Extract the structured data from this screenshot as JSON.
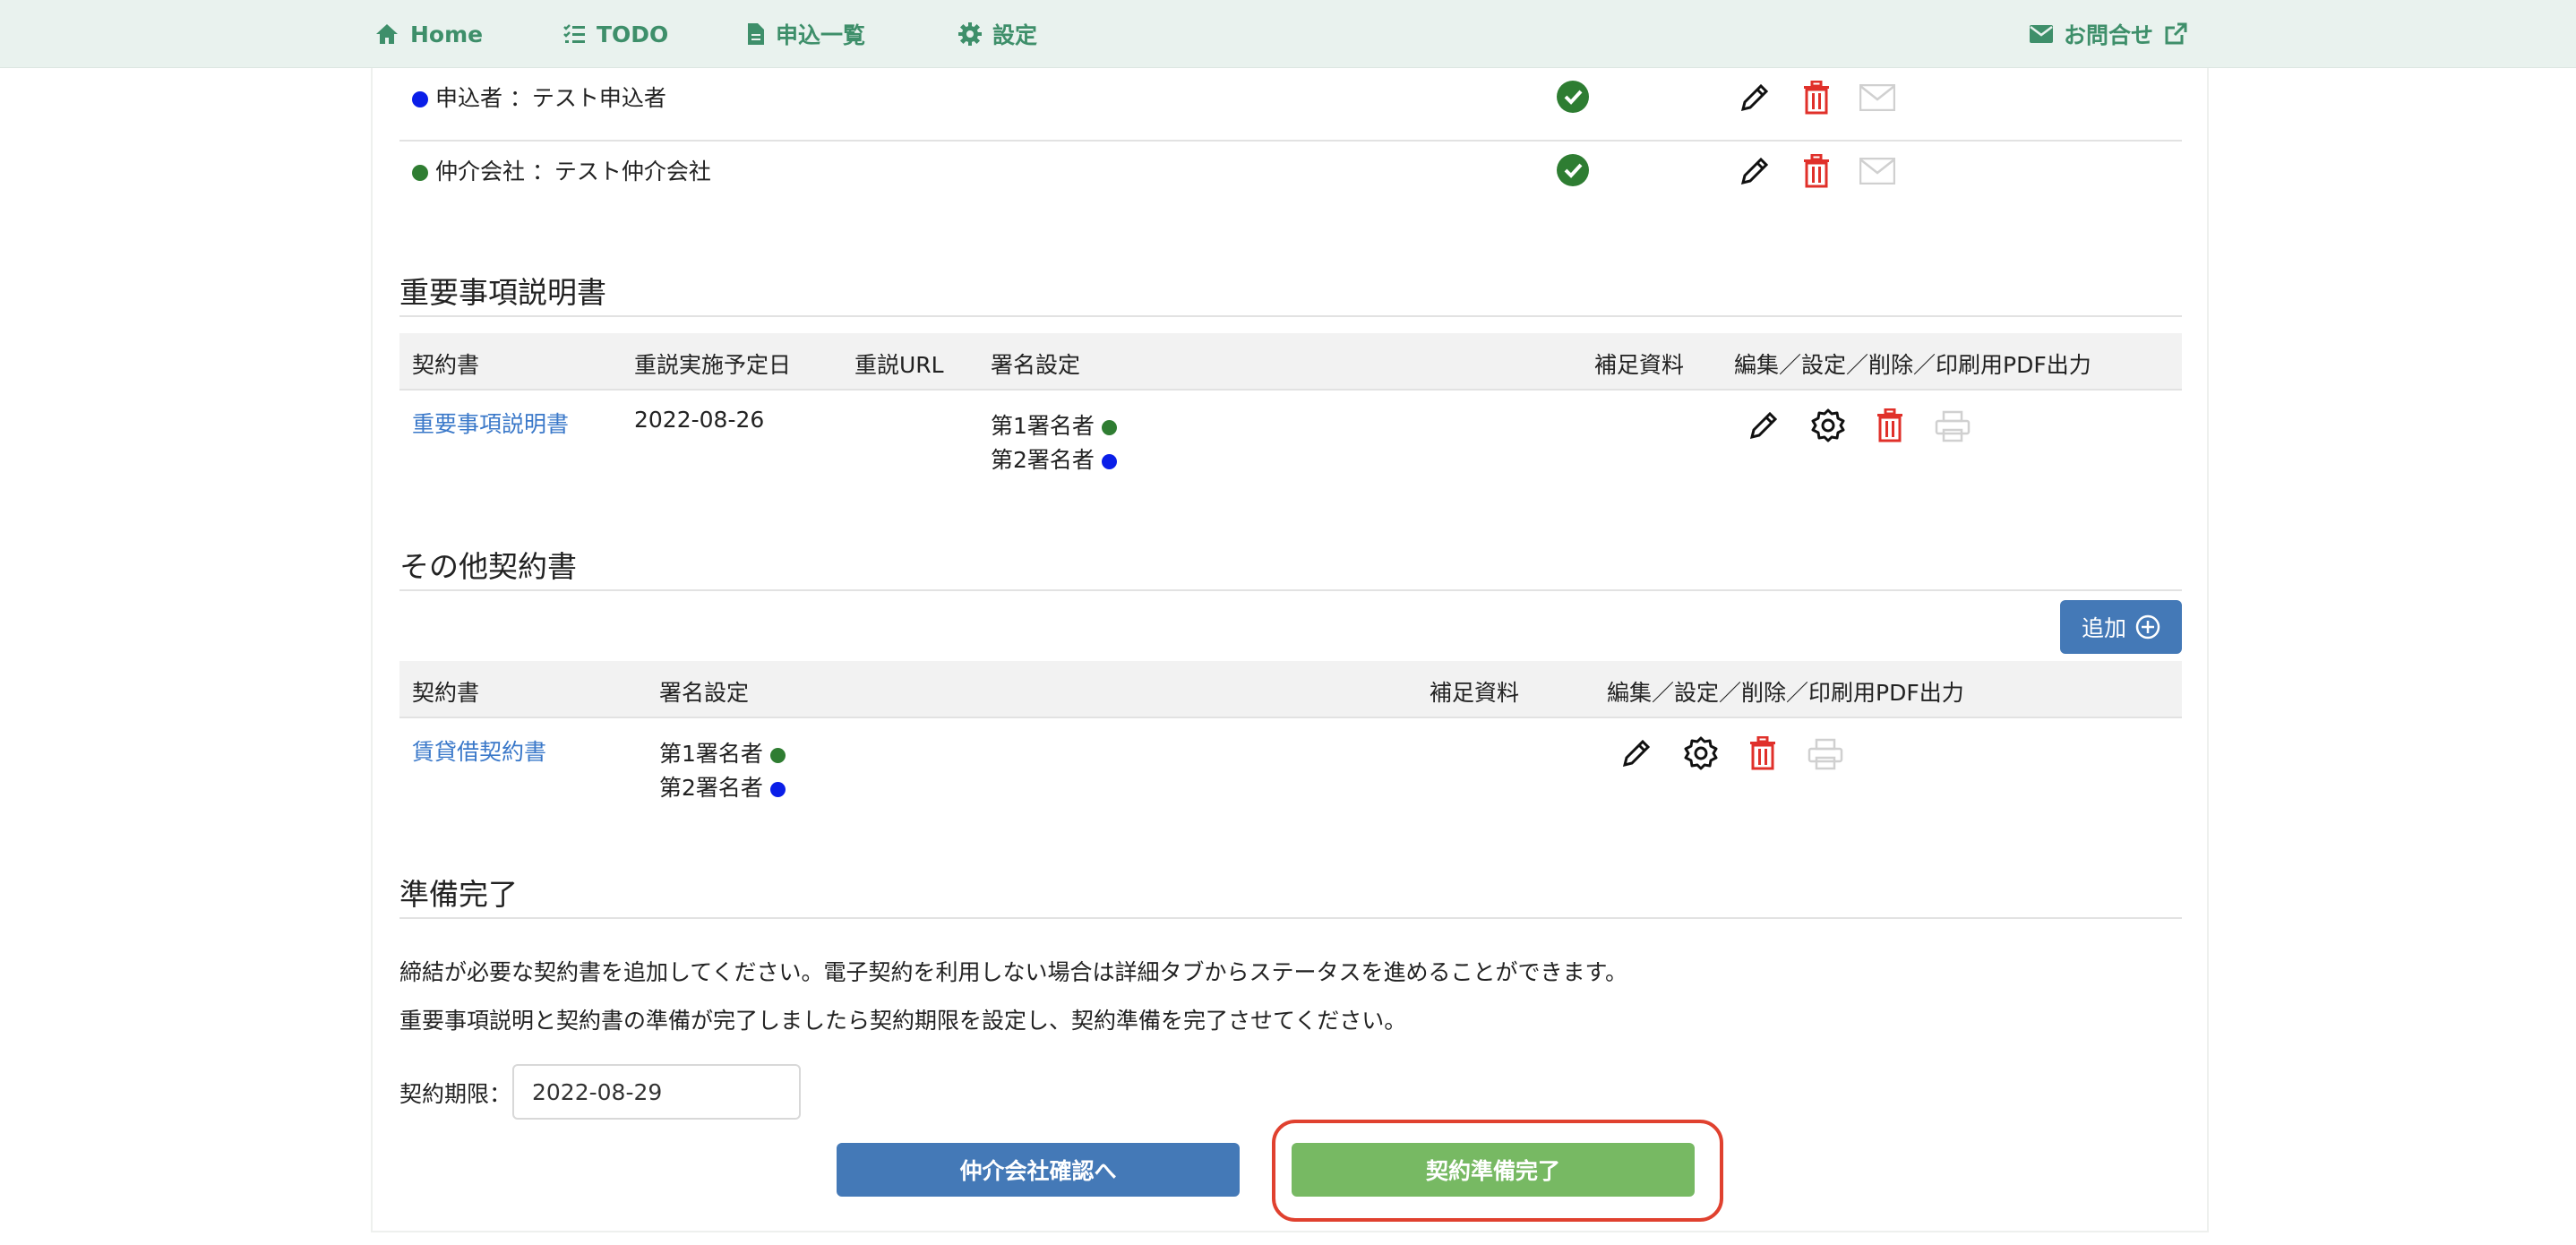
{
  "nav": {
    "home": "Home",
    "todo": "TODO",
    "applications": "申込一覧",
    "settings": "設定",
    "contact": "お問合せ"
  },
  "signers": [
    {
      "label": "申込者 ：テスト申込者",
      "dot_color": "#0a1ee8"
    },
    {
      "label": "仲介会社 ：テスト仲介会社",
      "dot_color": "#2f7d32"
    }
  ],
  "important_section": {
    "title": "重要事項説明書",
    "headers": {
      "contract": "契約書",
      "date": "重説実施予定日",
      "url": "重説URL",
      "signature": "署名設定",
      "supplement": "補足資料",
      "actions": "編集／設定／削除／印刷用PDF出力"
    },
    "row": {
      "contract": "重要事項説明書",
      "date": "2022-08-26",
      "signer1": "第1署名者",
      "signer2": "第2署名者"
    }
  },
  "other_section": {
    "title": "その他契約書",
    "add_button": "追加",
    "headers": {
      "contract": "契約書",
      "signature": "署名設定",
      "supplement": "補足資料",
      "actions": "編集／設定／削除／印刷用PDF出力"
    },
    "row": {
      "contract": "賃貸借契約書",
      "signer1": "第1署名者",
      "signer2": "第2署名者"
    }
  },
  "ready_section": {
    "title": "準備完了",
    "text1": "締結が必要な契約書を追加してください。電子契約を利用しない場合は詳細タブからステータスを進めることができます。",
    "text2": "重要事項説明と契約書の準備が完了しましたら契約期限を設定し、契約準備を完了させてください。",
    "deadline_label": "契約期限：",
    "deadline_value": "2022-08-29",
    "broker_button": "仲介会社確認へ",
    "complete_button": "契約準備完了"
  },
  "colors": {
    "nav_bg": "#e9f2ee",
    "nav_text": "#3e8f6a",
    "link": "#3a78c9",
    "primary_button": "#4479b7",
    "success_button": "#77b963",
    "delete_icon": "#e0302a",
    "highlight": "#e0412f"
  }
}
